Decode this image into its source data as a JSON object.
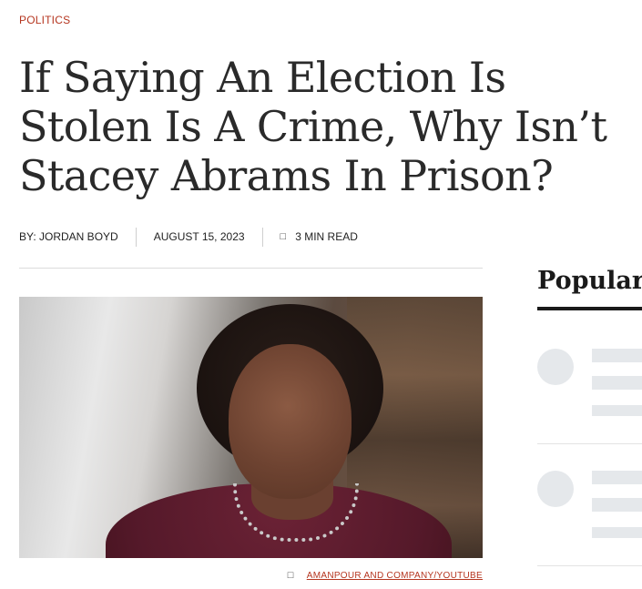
{
  "article": {
    "category": "POLITICS",
    "headline": "If Saying An Election Is Stolen Is A Crime, Why Isn’t Stacey Abrams In Prison?",
    "author": "BY: JORDAN BOYD",
    "date": "AUGUST 15, 2023",
    "read_time": "3 MIN READ",
    "photo_credit": "AMANPOUR AND COMPANY/YOUTUBE"
  },
  "sidebar": {
    "title": "Popular"
  },
  "icons": {
    "clock": "clock-icon",
    "camera": "camera-icon"
  },
  "colors": {
    "accent": "#b5351f",
    "skeleton": "#e5e8eb",
    "text": "#1a1a1a"
  }
}
